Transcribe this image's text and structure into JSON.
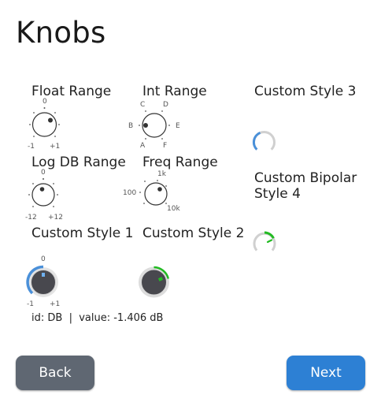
{
  "page": {
    "title": "Knobs"
  },
  "knobs": {
    "float_range": {
      "label": "Float Range",
      "top": "0",
      "left": "-1",
      "right": "+1"
    },
    "int_range": {
      "label": "Int Range",
      "ticks": [
        "A",
        "B",
        "C",
        "D",
        "E",
        "F"
      ]
    },
    "log_db_range": {
      "label": "Log DB Range",
      "top": "0",
      "left": "-12",
      "right": "+12"
    },
    "freq_range": {
      "label": "Freq Range",
      "top": "1k",
      "left": "100",
      "right": "10k"
    },
    "custom_style_1": {
      "label": "Custom Style 1",
      "top": "0",
      "left": "-1",
      "right": "+1"
    },
    "custom_style_2": {
      "label": "Custom Style 2"
    },
    "custom_style_3": {
      "label": "Custom Style 3"
    },
    "custom_bipolar_4": {
      "label": "Custom Bipolar Style 4"
    }
  },
  "status": {
    "text": "id: DB  |  value: -1.406 dB"
  },
  "buttons": {
    "back": "Back",
    "next": "Next"
  },
  "colors": {
    "blue_accent": "#4a90d9",
    "green_accent": "#22bb22",
    "back_button": "#5f6772",
    "next_button": "#2d80d4"
  }
}
